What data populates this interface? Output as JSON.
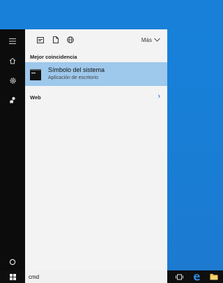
{
  "filters": {
    "more_label": "Más"
  },
  "results": {
    "section_header": "Mejor coincidencia",
    "best_match": {
      "title": "Símbolo del sistema",
      "subtitle": "Aplicación de escritorio",
      "icon": "command-prompt-icon"
    },
    "web_label": "Web",
    "web_chevron": "›"
  },
  "search": {
    "value": "cmd"
  },
  "colors": {
    "accent": "#1f6fc3",
    "selection": "#9ec8ec",
    "rail": "#0c0c0c",
    "desktop": "#1980d9"
  }
}
